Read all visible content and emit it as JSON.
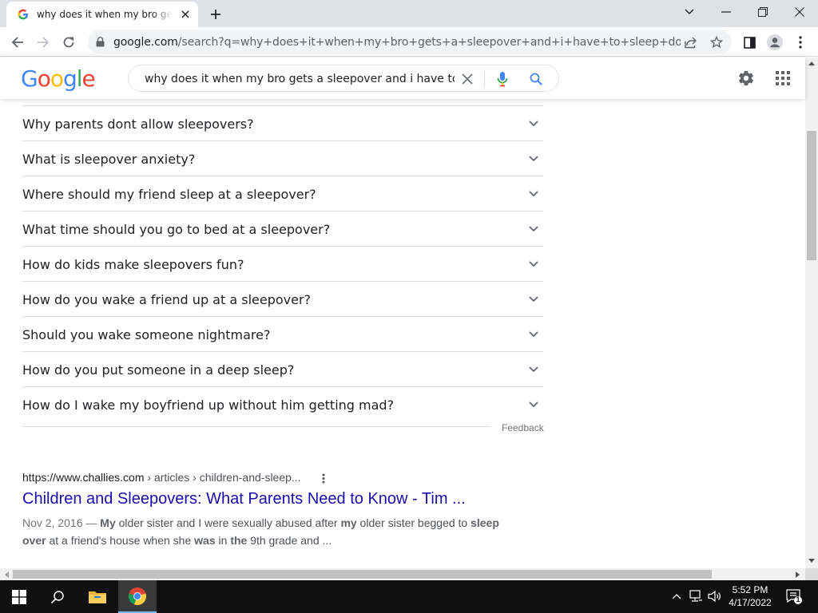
{
  "browser": {
    "tab": {
      "title": "why does it when my bro gets a sleepover and i have to sleep downstairs - Google Search",
      "favicon": "google-g-icon"
    },
    "new_tab_icon": "plus-icon",
    "window_controls": [
      "chevron-down-icon",
      "minimize-icon",
      "restore-icon",
      "close-icon"
    ],
    "address": {
      "host": "google.com",
      "path": "/search?q=why+does+it+when+my+bro+gets+a+sleepover+and+i+have+to+sleep+downstairs&rl...",
      "icons": [
        "lock-icon",
        "share-icon",
        "star-icon"
      ]
    },
    "toolbar_icons": [
      "back-arrow-icon",
      "forward-arrow-icon",
      "reload-icon",
      "side-panel-icon",
      "profile-icon",
      "kebab-menu-icon"
    ]
  },
  "google": {
    "logo": "Google",
    "logo_colors": [
      "#4285F4",
      "#EA4335",
      "#FBBC05",
      "#4285F4",
      "#34A853",
      "#EA4335"
    ],
    "search_query": "why does it when my bro gets a sleepover and i have to sleep downstairs",
    "header_icons": [
      "clear-x-icon",
      "microphone-icon",
      "search-icon",
      "settings-gear-icon",
      "apps-grid-icon"
    ]
  },
  "people_also_ask": [
    "Why parents dont allow sleepovers?",
    "What is sleepover anxiety?",
    "Where should my friend sleep at a sleepover?",
    "What time should you go to bed at a sleepover?",
    "How do kids make sleepovers fun?",
    "How do you wake a friend up at a sleepover?",
    "Should you wake someone nightmare?",
    "How do you put someone in a deep sleep?",
    "How do I wake my boyfriend up without him getting mad?"
  ],
  "feedback_label": "Feedback",
  "result": {
    "url": "https://www.challies.com",
    "breadcrumbs": " › articles › children-and-sleep...",
    "title": "Children and Sleepovers: What Parents Need to Know - Tim ...",
    "date": "Nov 2, 2016 — ",
    "snippet_parts": [
      {
        "t": "My",
        "b": true
      },
      {
        "t": " older sister and I were sexually abused after ",
        "b": false
      },
      {
        "t": "my",
        "b": true
      },
      {
        "t": " older sister begged to ",
        "b": false
      },
      {
        "t": "sleep over",
        "b": true
      },
      {
        "t": " at a friend's house when she ",
        "b": false
      },
      {
        "t": "was",
        "b": true
      },
      {
        "t": " in ",
        "b": false
      },
      {
        "t": "the",
        "b": true
      },
      {
        "t": " 9th grade and ...",
        "b": false
      }
    ]
  },
  "taskbar": {
    "time": "5:52 PM",
    "date": "4/17/2022",
    "notification_count": "1",
    "items": [
      "windows-start-icon",
      "search-icon",
      "file-explorer-icon",
      "chrome-icon"
    ],
    "tray": [
      "chevron-up-icon",
      "network-icon",
      "volume-icon",
      "notification-icon"
    ]
  }
}
